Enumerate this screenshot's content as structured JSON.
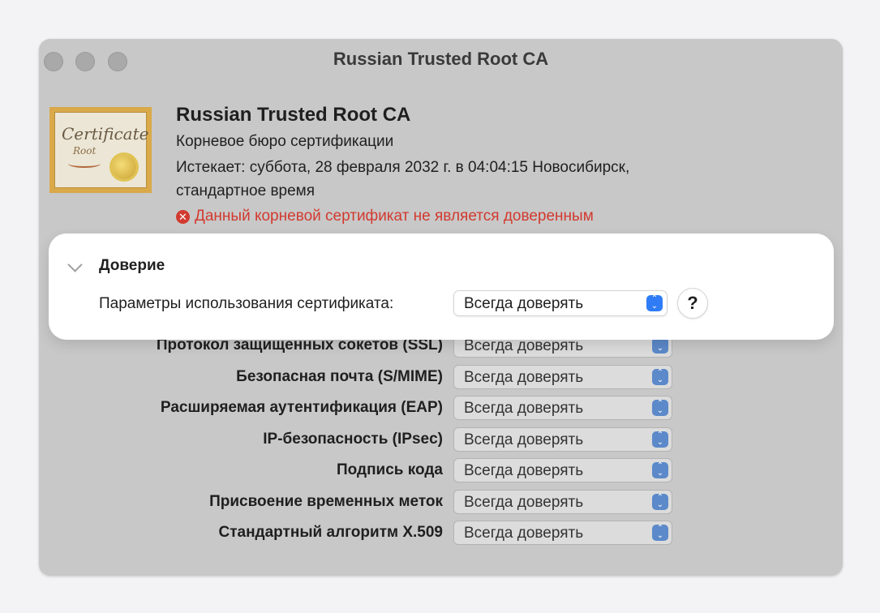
{
  "window": {
    "title": "Russian Trusted Root CA"
  },
  "certificate": {
    "icon_word": "Certificate",
    "icon_sub": "Root",
    "name": "Russian Trusted Root CA",
    "type": "Корневое бюро сертификации",
    "expires_line1": "Истекает: суббота, 28 февраля 2032 г. в 04:04:15 Новосибирск,",
    "expires_line2": "стандартное время",
    "warning_icon": "x-circle-icon",
    "warning": "Данный корневой сертификат не является доверенным"
  },
  "trust": {
    "section_title": "Доверие",
    "usage_label": "Параметры использования сертификата:",
    "usage_value": "Всегда доверять",
    "help_label": "?"
  },
  "policies": [
    {
      "label": "Протокол защищенных сокетов (SSL)",
      "value": "Всегда доверять"
    },
    {
      "label": "Безопасная почта (S/MIME)",
      "value": "Всегда доверять"
    },
    {
      "label": "Расширяемая аутентификация (EAP)",
      "value": "Всегда доверять"
    },
    {
      "label": "IP-безопасность (IPsec)",
      "value": "Всегда доверять"
    },
    {
      "label": "Подпись кода",
      "value": "Всегда доверять"
    },
    {
      "label": "Присвоение временных меток",
      "value": "Всегда доверять"
    },
    {
      "label": "Стандартный алгоритм X.509",
      "value": "Всегда доверять"
    }
  ]
}
